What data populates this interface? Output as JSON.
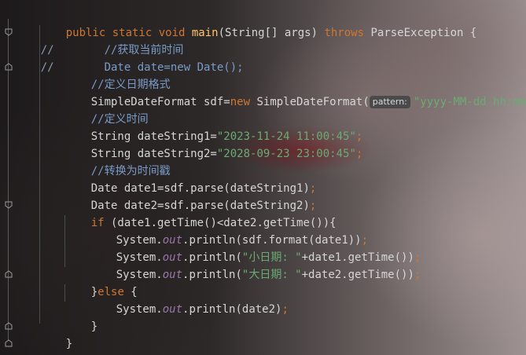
{
  "code": {
    "l1": {
      "kw1": "public static void ",
      "name": "main",
      "params": "(String[] args) ",
      "kw2": "throws",
      "rest": " ParseException {"
    },
    "l2": {
      "prefix": "//",
      "comment": "//获取当前时间"
    },
    "l3": {
      "prefix": "//",
      "text": "Date date=new Date();"
    },
    "l4": {
      "comment": "//定义日期格式"
    },
    "l5": {
      "a": "SimpleDateFormat sdf=",
      "kw": "new",
      "b": " SimpleDateFormat(",
      "hint": "pattern:",
      "str": "\"yyyy-MM-dd hh:mm:ss\"",
      "end": ");"
    },
    "l6": {
      "comment": "//定义时间"
    },
    "l7": {
      "a": "String dateString1=",
      "str": "\"2023-11-24 11:00:45\"",
      "end": ";"
    },
    "l8": {
      "a": "String dateString2=",
      "str": "\"2028-09-23 23:00:45\"",
      "end": ";"
    },
    "l9": {
      "comment": "//转换为时间戳"
    },
    "l10": {
      "a": "Date date1=sdf.parse(dateString1)",
      "end": ";"
    },
    "l11": {
      "a": "Date date2=sdf.parse(dateString2)",
      "end": ";"
    },
    "l12": {
      "kw": "if",
      "a": " (date1.getTime()<date2.getTime()){"
    },
    "l13": {
      "a": "System.",
      "field": "out",
      "b": ".println(sdf.format(date1))",
      "end": ";"
    },
    "l14": {
      "a": "System.",
      "field": "out",
      "b": ".println(",
      "str": "\"小日期: \"",
      "c": "+date1.getTime())",
      "end": ";"
    },
    "l15": {
      "a": "System.",
      "field": "out",
      "b": ".println(",
      "str": "\"大日期: \"",
      "c": "+date2.getTime())",
      "end": ";"
    },
    "l16": {
      "a": "}",
      "kw": "else",
      "b": " {"
    },
    "l17": {
      "a": "System.",
      "field": "out",
      "b": ".println(date2)",
      "end": ";"
    },
    "l18": {
      "a": "}"
    },
    "l19": {
      "a": "}"
    },
    "l20": {
      "a": "}"
    }
  },
  "colors": {
    "keyword": "#cc7832",
    "string": "#6aab73",
    "comment": "#7a9bc7",
    "field": "#9876aa",
    "text": "#d6d6d6"
  },
  "gutter_icons": [
    "fold-start-icon",
    "fold-end-icon"
  ]
}
